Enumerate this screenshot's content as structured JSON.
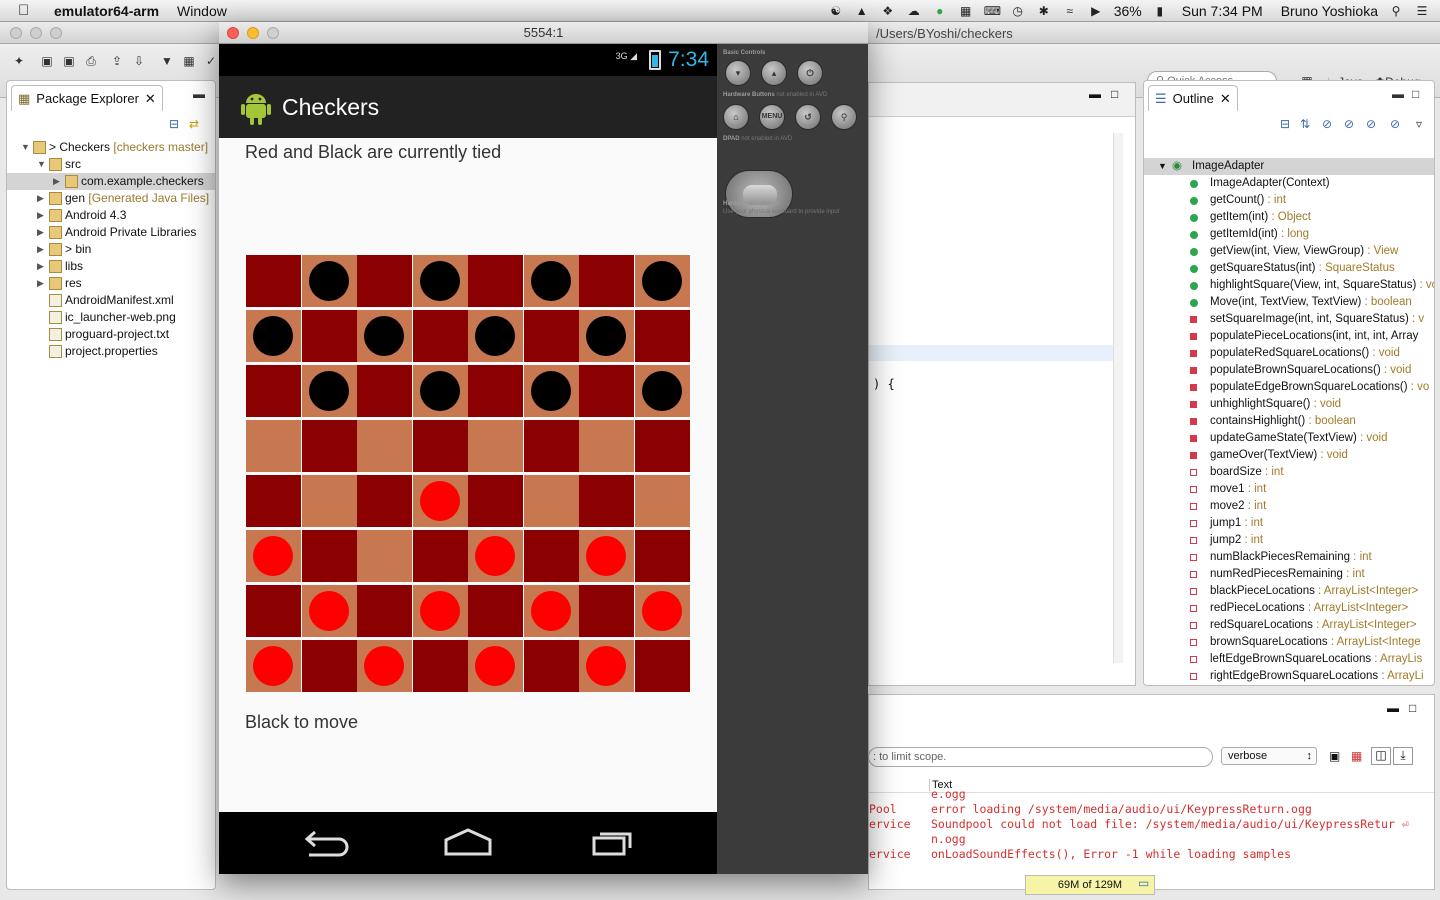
{
  "menubar": {
    "app": "emulator64-arm",
    "menu": "Window",
    "battery": "36%",
    "clock": "Sun 7:34 PM",
    "user": "Bruno Yoshioka"
  },
  "eclipse": {
    "path": "/Users/BYoshi/checkers",
    "quick_access": "Quick Access",
    "perspectives": [
      "Java",
      "Debug"
    ],
    "package_explorer": {
      "tab": "Package Explorer",
      "tree": [
        {
          "label": "> Checkers",
          "deco": "[checkers master]",
          "level": 0,
          "expanded": true
        },
        {
          "label": "src",
          "level": 1,
          "expanded": true
        },
        {
          "label": "com.example.checkers",
          "level": 2,
          "selected": true
        },
        {
          "label": "gen",
          "deco": "[Generated Java Files]",
          "level": 1
        },
        {
          "label": "Android 4.3",
          "level": 1
        },
        {
          "label": "Android Private Libraries",
          "level": 1
        },
        {
          "label": "> bin",
          "level": 1
        },
        {
          "label": "libs",
          "level": 1
        },
        {
          "label": "res",
          "level": 1
        },
        {
          "label": "AndroidManifest.xml",
          "level": 1,
          "leaf": true
        },
        {
          "label": "ic_launcher-web.png",
          "level": 1,
          "leaf": true
        },
        {
          "label": "proguard-project.txt",
          "level": 1,
          "leaf": true
        },
        {
          "label": "project.properties",
          "level": 1,
          "leaf": true
        }
      ]
    },
    "editor_code": ") {",
    "outline": {
      "tab": "Outline",
      "root": "ImageAdapter",
      "members": [
        {
          "name": "ImageAdapter(Context)",
          "type": "",
          "kind": "ctor"
        },
        {
          "name": "getCount()",
          "type": "int",
          "kind": "public"
        },
        {
          "name": "getItem(int)",
          "type": "Object",
          "kind": "public"
        },
        {
          "name": "getItemId(int)",
          "type": "long",
          "kind": "public"
        },
        {
          "name": "getView(int, View, ViewGroup)",
          "type": "View",
          "kind": "public"
        },
        {
          "name": "getSquareStatus(int)",
          "type": "SquareStatus",
          "kind": "public"
        },
        {
          "name": "highlightSquare(View, int, SquareStatus)",
          "type": "void",
          "kind": "public"
        },
        {
          "name": "Move(int, TextView, TextView)",
          "type": "boolean",
          "kind": "public"
        },
        {
          "name": "setSquareImage(int, int, SquareStatus)",
          "type": "v",
          "kind": "private"
        },
        {
          "name": "populatePieceLocations(int, int, int, Array",
          "type": "",
          "kind": "private"
        },
        {
          "name": "populateRedSquareLocations()",
          "type": "void",
          "kind": "private"
        },
        {
          "name": "populateBrownSquareLocations()",
          "type": "void",
          "kind": "private"
        },
        {
          "name": "populateEdgeBrownSquareLocations()",
          "type": "vo",
          "kind": "private"
        },
        {
          "name": "unhighlightSquare()",
          "type": "void",
          "kind": "private"
        },
        {
          "name": "containsHighlight()",
          "type": "boolean",
          "kind": "private"
        },
        {
          "name": "updateGameState(TextView)",
          "type": "void",
          "kind": "private"
        },
        {
          "name": "gameOver(TextView)",
          "type": "void",
          "kind": "private"
        },
        {
          "name": "boardSize",
          "type": "int",
          "kind": "field"
        },
        {
          "name": "move1",
          "type": "int",
          "kind": "field"
        },
        {
          "name": "move2",
          "type": "int",
          "kind": "field"
        },
        {
          "name": "jump1",
          "type": "int",
          "kind": "field"
        },
        {
          "name": "jump2",
          "type": "int",
          "kind": "field"
        },
        {
          "name": "numBlackPiecesRemaining",
          "type": "int",
          "kind": "field"
        },
        {
          "name": "numRedPiecesRemaining",
          "type": "int",
          "kind": "field"
        },
        {
          "name": "blackPieceLocations",
          "type": "ArrayList<Integer>",
          "kind": "field"
        },
        {
          "name": "redPieceLocations",
          "type": "ArrayList<Integer>",
          "kind": "field"
        },
        {
          "name": "redSquareLocations",
          "type": "ArrayList<Integer>",
          "kind": "field"
        },
        {
          "name": "brownSquareLocations",
          "type": "ArrayList<Intege",
          "kind": "field"
        },
        {
          "name": "leftEdgeBrownSquareLocations",
          "type": "ArrayLis",
          "kind": "field"
        },
        {
          "name": "rightEdgeBrownSquareLocations",
          "type": "ArrayLi",
          "kind": "field"
        }
      ]
    },
    "console": {
      "filter_placeholder": ": to limit scope.",
      "level": "verbose",
      "col_text": "Text",
      "logs": [
        {
          "tag": "",
          "text": "e.ogg"
        },
        {
          "tag": "Pool",
          "text": "error loading /system/media/audio/ui/KeypressReturn.ogg"
        },
        {
          "tag": "ervice",
          "text": "Soundpool could not load file: /system/media/audio/ui/KeypressRetur ⏎"
        },
        {
          "tag": "",
          "text": "n.ogg"
        },
        {
          "tag": "ervice",
          "text": "onLoadSoundEffects(), Error -1 while loading samples"
        }
      ]
    },
    "memory": "69M of 129M"
  },
  "emulator": {
    "title": "5554:1",
    "clock": "7:34",
    "network": "3G",
    "app_title": "Checkers",
    "status_text": "Red and Black are currently tied",
    "turn_text": "Black to move",
    "colors": {
      "dark_square": "#8b0000",
      "light_square": "#c87850",
      "black_piece": "#000000",
      "red_piece": "#ff0000",
      "accent": "#33b5e5"
    },
    "board": [
      "D,L:b,D,L:b,D,L:b,D,L:b",
      "L:b,D,L:b,D,L:b,D,L:b,D",
      "D,L:b,D,L:b,D,L:b,D,L:b",
      "L,D,L,D,L,D,L,D",
      "D,L,D,L:r,D,L,D,L",
      "L:r,D,L,D,L:r,D,L:r,D",
      "D,L:r,D,L:r,D,L:r,D,L:r",
      "L:r,D,L:r,D,L:r,D,L:r,D"
    ],
    "controls": {
      "basic": "Basic Controls",
      "hw": "Hardware Buttons",
      "hw_sub": "not enabled in AVD",
      "menu": "MENU",
      "dpad": "DPAD",
      "dpad_sub": "not enabled in AVD",
      "kbd": "Hardware Keyboard",
      "kbd_sub": "Use your physical keyboard to provide input"
    }
  }
}
